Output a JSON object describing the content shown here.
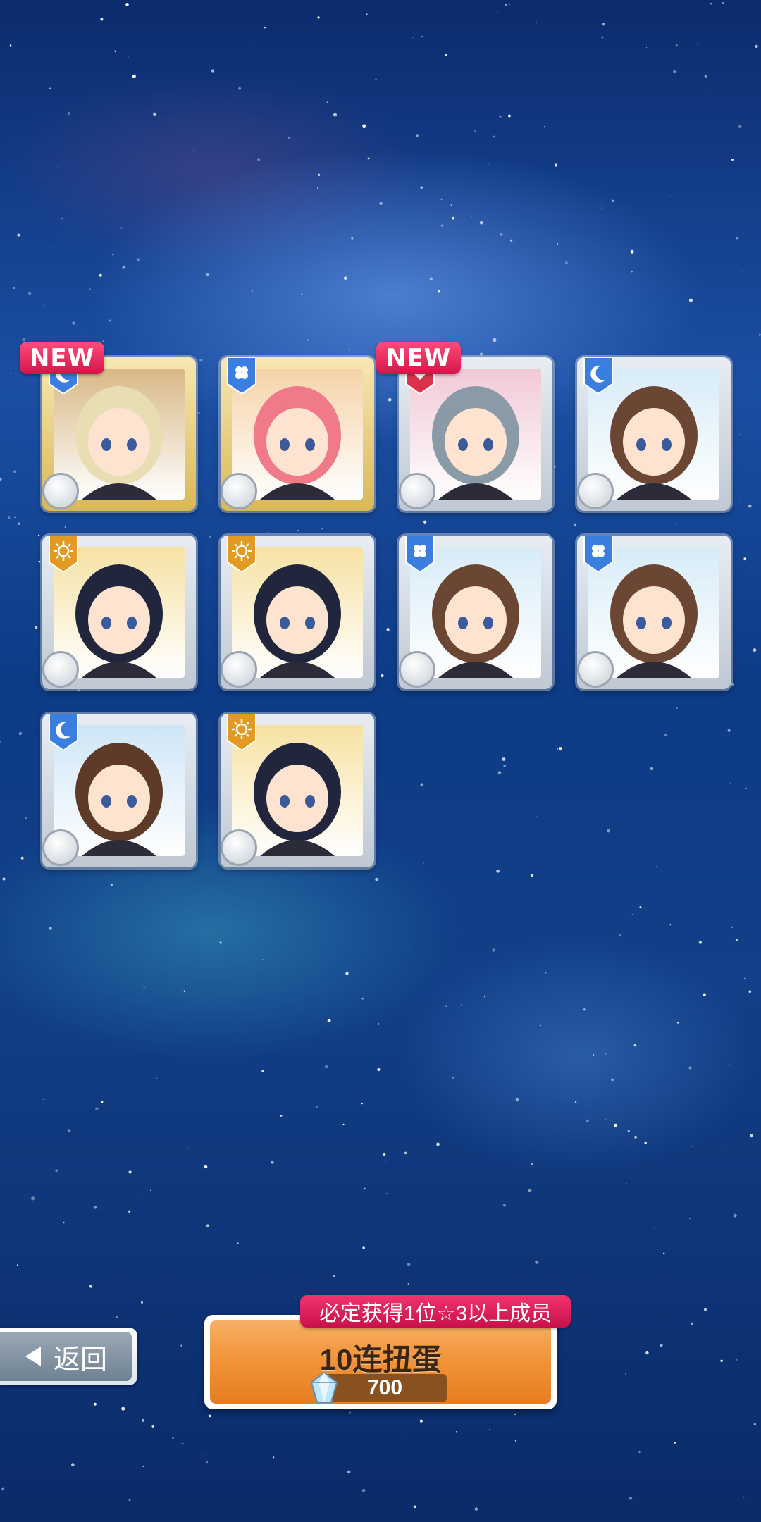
{
  "cards": [
    {
      "new": true,
      "frame": "gold",
      "attribute": "moon-icon",
      "attribute_color": "#3a7fe0",
      "weapon": "blade-weapon-icon",
      "hair": "#e9ddb4",
      "bg": "#d9b886"
    },
    {
      "new": false,
      "frame": "gold",
      "attribute": "clover-icon",
      "attribute_color": "#3a7fe0",
      "weapon": "hammer-weapon-icon",
      "hair": "#f07a8a",
      "bg": "#f6d3a8"
    },
    {
      "new": true,
      "frame": "silver",
      "attribute": "heart-icon",
      "attribute_color": "#d8334a",
      "weapon": "gear-weapon-icon",
      "hair": "#8a9aa6",
      "bg": "#f1c9d6"
    },
    {
      "new": false,
      "frame": "silver",
      "attribute": "moon-icon",
      "attribute_color": "#3a7fe0",
      "weapon": "blade-weapon-icon",
      "hair": "#6b4733",
      "bg": "#d7ecf8"
    },
    {
      "new": false,
      "frame": "silver",
      "attribute": "sun-icon",
      "attribute_color": "#e39a22",
      "weapon": "gun-weapon-icon",
      "hair": "#22263d",
      "bg": "#f7e2a3"
    },
    {
      "new": false,
      "frame": "silver",
      "attribute": "sun-icon",
      "attribute_color": "#e39a22",
      "weapon": "gun-weapon-icon",
      "hair": "#22263d",
      "bg": "#f7e2a3"
    },
    {
      "new": false,
      "frame": "silver",
      "attribute": "clover-icon",
      "attribute_color": "#3a7fe0",
      "weapon": "blade-weapon-icon",
      "hair": "#6b4733",
      "bg": "#d7ecf8"
    },
    {
      "new": false,
      "frame": "silver",
      "attribute": "clover-icon",
      "attribute_color": "#3a7fe0",
      "weapon": "blade-weapon-icon",
      "hair": "#6b4733",
      "bg": "#d7ecf8"
    },
    {
      "new": false,
      "frame": "silver",
      "attribute": "moon-icon",
      "attribute_color": "#3a7fe0",
      "weapon": "bow-weapon-icon",
      "hair": "#5d3b28",
      "bg": "#cfe6f7"
    },
    {
      "new": false,
      "frame": "silver",
      "attribute": "sun-icon",
      "attribute_color": "#e39a22",
      "weapon": "gun-weapon-icon",
      "hair": "#22263d",
      "bg": "#f7e2a3"
    }
  ],
  "new_label": "NEW",
  "back_button": {
    "label": "返回"
  },
  "gacha_button": {
    "guarantee_text": "必定获得1位☆3以上成员",
    "title": "10连扭蛋",
    "cost": "700"
  }
}
